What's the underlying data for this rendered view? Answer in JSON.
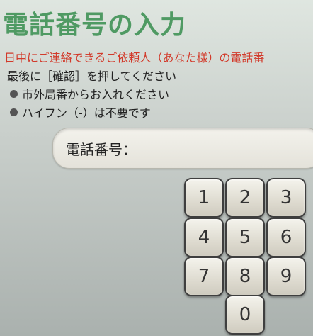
{
  "title": "電話番号の入力",
  "instructions": {
    "red": "日中にご連絡できるご依頼人（あなた様）の電話番",
    "main": "最後に［確認］を押してください",
    "bullets": [
      "市外局番からお入れください",
      "ハイフン（-）は不要です"
    ]
  },
  "phone_field": {
    "label": "電話番号：",
    "value": ""
  },
  "keypad": {
    "keys": [
      "1",
      "2",
      "3",
      "4",
      "5",
      "6",
      "7",
      "8",
      "9",
      "0"
    ]
  },
  "colors": {
    "title": "#4f9a63",
    "instruction_red": "#d23a2b"
  }
}
